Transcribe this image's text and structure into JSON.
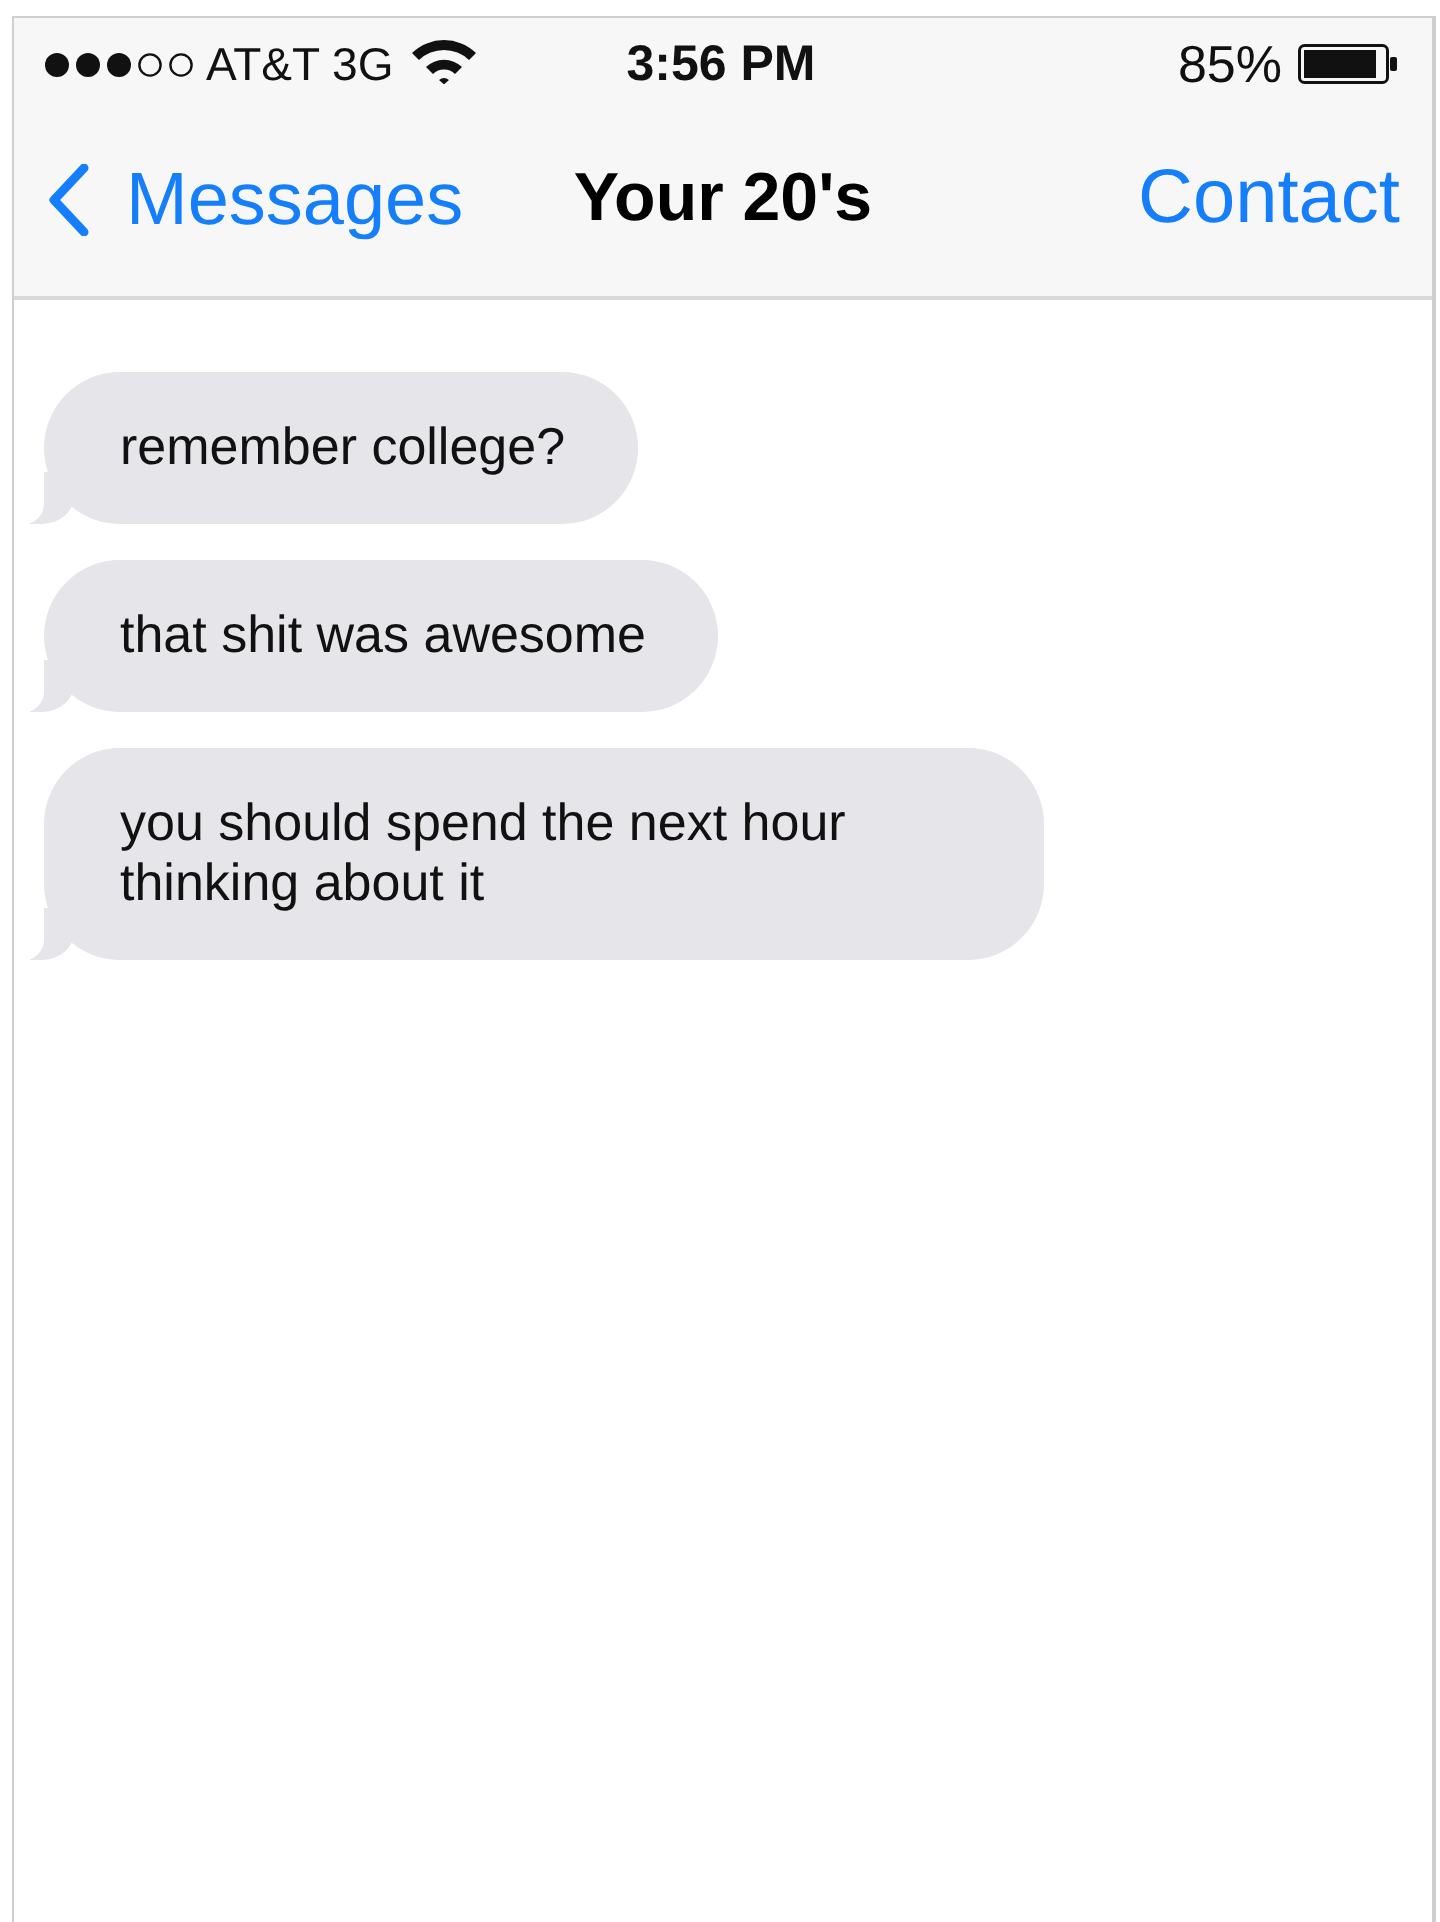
{
  "status_bar": {
    "carrier": "AT&T 3G",
    "time": "3:56 PM",
    "battery": "85%"
  },
  "nav_bar": {
    "back": "Messages",
    "title": "Your 20's",
    "action": "Contact"
  },
  "messages": [
    {
      "text": "remember college?"
    },
    {
      "text": "that shit was awesome"
    },
    {
      "text": "you should spend the next hour thinking about it"
    }
  ]
}
